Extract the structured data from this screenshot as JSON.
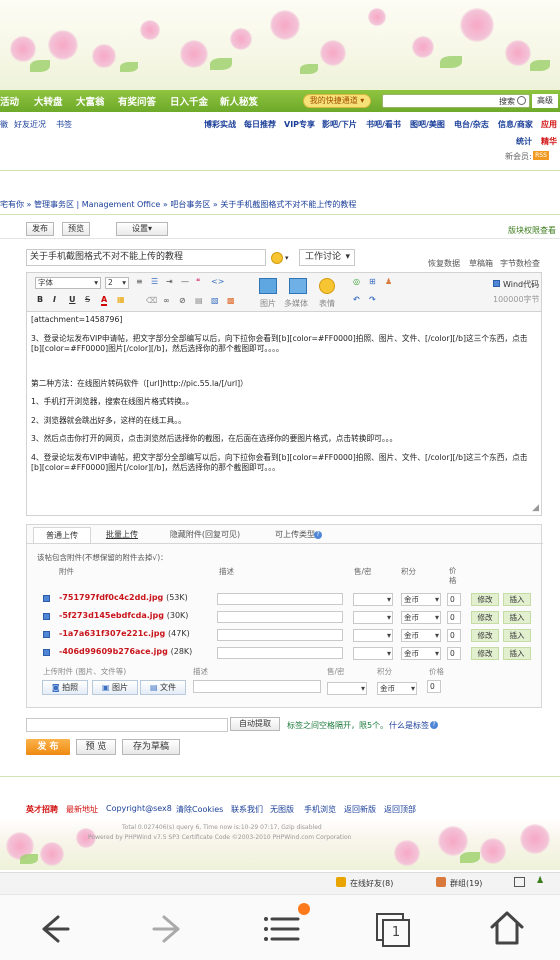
{
  "nav": {
    "items": [
      "活动",
      "大转盘",
      "大富翁",
      "有奖问答",
      "日入千金",
      "新人秘笈"
    ],
    "quick_channel": "我的快捷通道 ▾",
    "search_label": "搜索",
    "advanced": "高级"
  },
  "subnav": {
    "left": [
      "徽",
      "好友近况",
      "书签"
    ],
    "right": [
      "博彩实战",
      "每日推荐",
      "VIP专享",
      "影吧/下片",
      "书吧/看书",
      "图吧/美图",
      "电台/杂志",
      "信息/商家",
      "应用"
    ],
    "row2": [
      "统计",
      "精华"
    ],
    "new_members": "新会员:",
    "rss": "RSS"
  },
  "breadcrumb": "宅有你 » 管理事务区 | Management Office » 吧台事务区 » 关于手机截图格式不对不能上传的教程",
  "topbar": {
    "post": "发布",
    "preview": "预览",
    "settings": "设置▾",
    "permissions": "版块权限查看"
  },
  "editor": {
    "title": "关于手机截图格式不对不能上传的教程",
    "category": "工作讨论",
    "links": [
      "恢复数据",
      "草稿箱",
      "字节数检查"
    ],
    "font": "字体",
    "size": "2",
    "toolbar_labels": [
      "图片",
      "多媒体",
      "表情"
    ],
    "wind_code": "Wind代码",
    "byte_limit": "100000字节",
    "content": [
      "[attachment=1458796]",
      "3、登录论坛发布VIP申请帖，把文字部分全部编写以后，向下拉你会看到[b][color=#FF0000]拍照、图片、文件、[/color][/b]这三个东西，点击[b][color=#FF0000]图片[/color][/b]，然后选择你的那个截图即可。。。。",
      "",
      "第二种方法：在线图片转码软件（[url]http://pic.55.la/[/url]）",
      "1、手机打开浏览器，搜索在线图片格式转换。。",
      "2、浏览器就会跳出好多，这样的在线工具。。",
      "3、然后点击你打开的网页，点击浏览然后选择你的截图，在后面在选择你的要图片格式，点击转换即可。。。",
      "4、登录论坛发布VIP申请帖，把文字部分全部编写以后，向下拉你会看到[b][color=#FF0000]拍照、图片、文件、[/color][/b]这三个东西，点击[b][color=#FF0000]图片[/color][/b]，然后选择你的那个截图即可。。。"
    ]
  },
  "upload": {
    "tabs": [
      "普通上传",
      "批量上传",
      "隐藏附件(回复可见)",
      "可上传类型"
    ],
    "note": "该帖包含附件(不想保留的附件去掉√)：",
    "headers": [
      "附件",
      "描述",
      "售/密",
      "积分",
      "价格"
    ],
    "files": [
      {
        "name": "-751797fdf0c4c2dd.jpg",
        "size": "(53K)",
        "currency": "金币",
        "price": "0"
      },
      {
        "name": "-5f273d145ebdfcda.jpg",
        "size": "(30K)",
        "currency": "金币",
        "price": "0"
      },
      {
        "name": "-1a7a631f307e221c.jpg",
        "size": "(47K)",
        "currency": "金币",
        "price": "0"
      },
      {
        "name": "-406d99609b276ace.jpg",
        "size": "(28K)",
        "currency": "金币",
        "price": "0"
      }
    ],
    "edit": "修改",
    "insert": "插入",
    "upload_header": [
      "上传附件 (图片、文件等)",
      "描述",
      "售/密",
      "积分",
      "价格"
    ],
    "upload_buttons": [
      "拍照",
      "图片",
      "文件"
    ],
    "upload_currency": "金币",
    "upload_price": "0"
  },
  "tags": {
    "auto": "自动提取",
    "hint": "标签之间空格隔开，限5个。",
    "what": "什么是标签"
  },
  "actions": {
    "publish": "发 布",
    "preview": "预 览",
    "draft": "存为草稿"
  },
  "footer": {
    "links": [
      "英才招聘",
      "最新地址",
      "Copyright@sex8",
      "清除Cookies",
      "联系我们",
      "无图版",
      "手机浏览",
      "返回新版",
      "返回顶部"
    ],
    "debug": "Total 0.027406(s) query 6, Time now is:10-29 07:17, Gzip disabled",
    "powered": "Powered by PHPWind v7.5 SP3 Certificate Code ©2003-2010 PHPWind.com Corporation"
  },
  "statusbar": {
    "online": "在线好友(8)",
    "groups": "群组(19)"
  },
  "browser": {
    "tabs_count": "1"
  }
}
